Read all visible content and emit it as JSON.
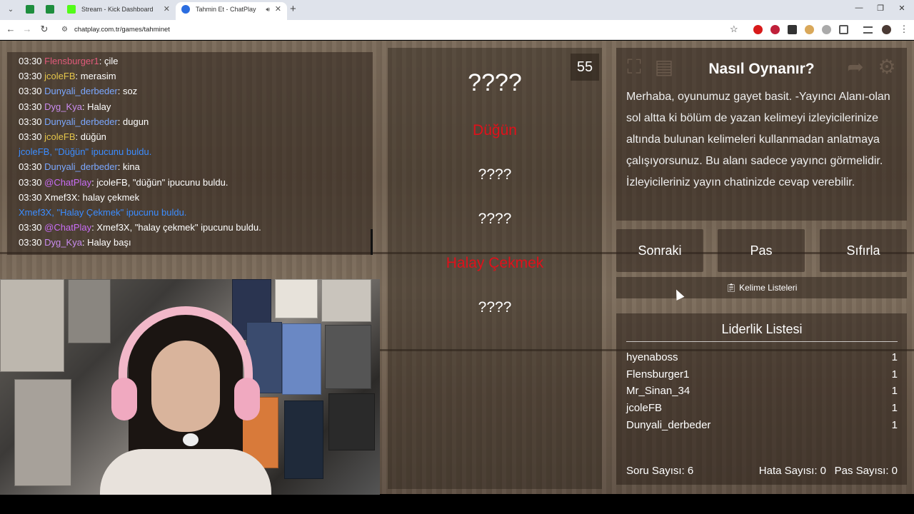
{
  "browser": {
    "tabs": [
      {
        "label": "",
        "favicon_color": "#1e8e3e"
      },
      {
        "label": "",
        "favicon_color": "#1e8e3e"
      },
      {
        "label": "Stream - Kick Dashboard",
        "favicon_color": "#53fc18"
      },
      {
        "label": "Tahmin Et - ChatPlay",
        "favicon_color": "#2b6de0"
      }
    ],
    "url": "chatplay.com.tr/games/tahminet"
  },
  "chat": {
    "lines": [
      {
        "time": "03:30",
        "user": "Flensburger1",
        "user_color": "#e05a7a",
        "msg": ": çile"
      },
      {
        "time": "03:30",
        "user": "jcoleFB",
        "user_color": "#e3c44a",
        "msg": ": merasim"
      },
      {
        "time": "03:30",
        "user": "Dunyali_derbeder",
        "user_color": "#7aa7ff",
        "msg": ": soz"
      },
      {
        "time": "03:30",
        "user": "Dyg_Kya",
        "user_color": "#c98cf0",
        "msg": ": Halay"
      },
      {
        "time": "03:30",
        "user": "Dunyali_derbeder",
        "user_color": "#7aa7ff",
        "msg": ": dugun"
      },
      {
        "time": "03:30",
        "user": "jcoleFB",
        "user_color": "#e3c44a",
        "msg": ": düğün"
      },
      {
        "time": "",
        "user": "jcoleFB,",
        "user_color": "#3b8cff",
        "msg": " \"Düğün\" ipucunu buldu.",
        "system": true
      },
      {
        "time": "03:30",
        "user": "Dunyali_derbeder",
        "user_color": "#7aa7ff",
        "msg": ": kina"
      },
      {
        "time": "03:30",
        "user": "@ChatPlay",
        "user_color": "#c86df5",
        "msg": ": jcoleFB, \"düğün\" ipucunu buldu."
      },
      {
        "time": "03:30",
        "user": "Xmef3X",
        "user_color": "#ffffff",
        "msg": ": halay çekmek"
      },
      {
        "time": "",
        "user": "Xmef3X,",
        "user_color": "#3b8cff",
        "msg": " \"Halay Çekmek\" ipucunu buldu.",
        "system": true
      },
      {
        "time": "03:30",
        "user": "@ChatPlay",
        "user_color": "#c86df5",
        "msg": ": Xmef3X, \"halay çekmek\" ipucunu buldu."
      },
      {
        "time": "03:30",
        "user": "Dyg_Kya",
        "user_color": "#c98cf0",
        "msg": ": Halay başı"
      }
    ]
  },
  "game": {
    "timer": "55",
    "main_word": "????",
    "clues": [
      {
        "text": "Düğün",
        "found": true
      },
      {
        "text": "????",
        "found": false
      },
      {
        "text": "????",
        "found": false
      },
      {
        "text": "Halay Çekmek",
        "found": true
      },
      {
        "text": "????",
        "found": false
      }
    ],
    "found_color": "#e0101a"
  },
  "howto": {
    "title": "Nasıl Oynanır?",
    "body": "Merhaba, oyunumuz gayet basit. -Yayıncı Alanı-olan sol altta ki bölüm de yazan kelimeyi izleyicilerinize altında bulunan kelimeleri kullanmadan anlatmaya çalışıyorsunuz. Bu alanı sadece yayıncı görmelidir. İzleyicileriniz yayın chatinizde cevap verebilir."
  },
  "controls": {
    "next": "Sonraki",
    "pass": "Pas",
    "reset": "Sıfırla",
    "word_lists": "Kelime Listeleri"
  },
  "leaderboard": {
    "title": "Liderlik Listesi",
    "rows": [
      {
        "name": "hyenaboss",
        "score": "1"
      },
      {
        "name": "Flensburger1",
        "score": "1"
      },
      {
        "name": "Mr_Sinan_34",
        "score": "1"
      },
      {
        "name": "jcoleFB",
        "score": "1"
      },
      {
        "name": "Dunyali_derbeder",
        "score": "1"
      }
    ],
    "stats": {
      "questions": "Soru Sayısı: 6",
      "errors": "Hata Sayısı: 0",
      "passes": "Pas Sayısı: 0"
    }
  }
}
